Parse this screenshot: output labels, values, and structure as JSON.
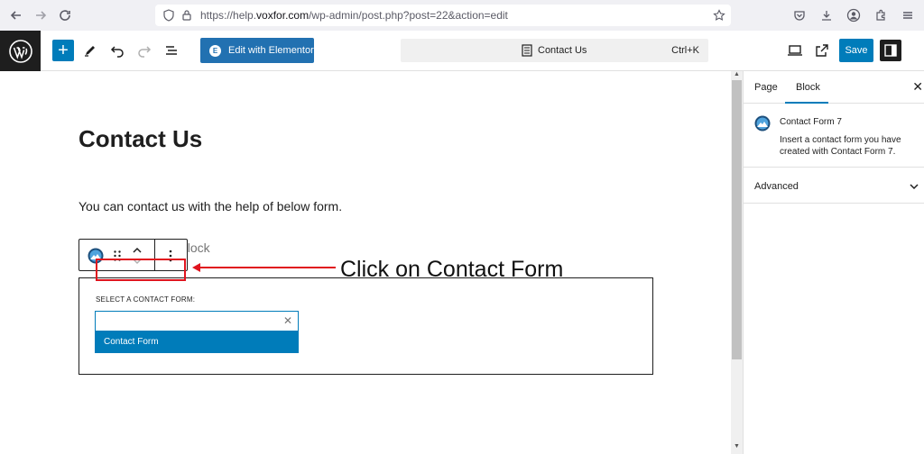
{
  "browser": {
    "url_prefix": "https://help.",
    "url_host": "voxfor.com",
    "url_path": "/wp-admin/post.php?post=22&action=edit"
  },
  "toolbar": {
    "elementor_label": "Edit with Elementor",
    "command_title": "Contact Us",
    "command_shortcut": "Ctrl+K",
    "save_label": "Save"
  },
  "editor": {
    "title": "Contact Us",
    "paragraph": "You can contact us with the help of below form.",
    "hidden_block_text": "block",
    "cf_label": "SELECT A CONTACT FORM:",
    "cf_input_value": "",
    "cf_option": "Contact Form"
  },
  "annotation": {
    "text": "Click on Contact Form",
    "color": "#e0141e"
  },
  "sidebar": {
    "tab_page": "Page",
    "tab_block": "Block",
    "block_name": "Contact Form 7",
    "block_description": "Insert a contact form you have created with Contact Form 7.",
    "advanced_label": "Advanced"
  },
  "colors": {
    "accent": "#007cba",
    "elementor": "#2271b1",
    "wp_dark": "#1e1e1e"
  }
}
